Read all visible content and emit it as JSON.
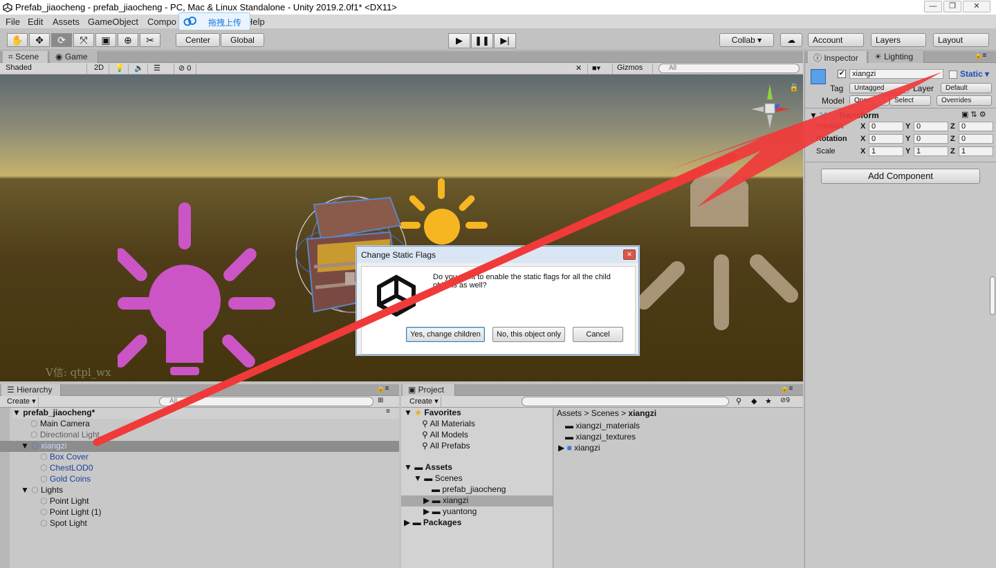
{
  "window": {
    "title": "Prefab_jiaocheng - prefab_jiaocheng - PC, Mac & Linux Standalone - Unity 2019.2.0f1* <DX11>",
    "min": "—",
    "max": "❐",
    "close": "✕"
  },
  "menu": [
    "File",
    "Edit",
    "Assets",
    "GameObject",
    "Compo",
    "Help"
  ],
  "upload_label": "拖拽上传",
  "toolbar": {
    "center": "Center",
    "global": "Global",
    "collab": "Collab ▾",
    "account": "Account",
    "layers": "Layers",
    "layout": "Layout"
  },
  "scene_tabs": {
    "scene": "Scene",
    "game": "Game",
    "shading": "Shaded",
    "mode2d": "2D",
    "hidden_count": "0",
    "gizmos": "Gizmos",
    "search_placeholder": "All",
    "watermark": "V信: qtpl_wx"
  },
  "dialog": {
    "title": "Change Static Flags",
    "message_line1": "Do you want to enable the static flags for all the child",
    "message_line2": "objects as well?",
    "yes": "Yes, change children",
    "no": "No, this object only",
    "cancel": "Cancel",
    "close": "✕"
  },
  "hierarchy": {
    "tab": "Hierarchy",
    "create": "Create",
    "search_placeholder": "All",
    "scene_name": "prefab_jiaocheng*",
    "items": [
      {
        "label": "Main Camera",
        "indent": 1,
        "style": "normal"
      },
      {
        "label": "Directional Light",
        "indent": 1,
        "style": "dim"
      },
      {
        "label": "xiangzi",
        "indent": 1,
        "style": "selected"
      },
      {
        "label": "Box Cover",
        "indent": 2,
        "style": "blue"
      },
      {
        "label": "ChestLOD0",
        "indent": 2,
        "style": "blue"
      },
      {
        "label": "Gold Coins",
        "indent": 2,
        "style": "blue"
      },
      {
        "label": "Lights",
        "indent": 1,
        "style": "normal"
      },
      {
        "label": "Point Light",
        "indent": 2,
        "style": "normal"
      },
      {
        "label": "Point Light (1)",
        "indent": 2,
        "style": "normal"
      },
      {
        "label": "Spot Light",
        "indent": 2,
        "style": "normal"
      }
    ]
  },
  "project": {
    "tab": "Project",
    "create": "Create",
    "hidden_count": "9",
    "favorites_label": "Favorites",
    "favorites": [
      "All Materials",
      "All Models",
      "All Prefabs"
    ],
    "assets_label": "Assets",
    "scenes_label": "Scenes",
    "scene_children": [
      "prefab_jiaocheng",
      "xiangzi",
      "yuantong"
    ],
    "packages_label": "Packages",
    "breadcrumb": [
      "Assets",
      "Scenes",
      "xiangzi"
    ],
    "files": [
      "xiangzi_materials",
      "xiangzi_textures",
      "xiangzi"
    ]
  },
  "inspector": {
    "tab": "Inspector",
    "lighting_tab": "Lighting",
    "object_name": "xiangzi",
    "static_label": "Static",
    "tag_label": "Tag",
    "tag_value": "Untagged",
    "layer_label": "Layer",
    "layer_value": "Default",
    "model_label": "Model",
    "open": "Open",
    "select": "Select",
    "overrides": "Overrides",
    "transform_label": "Transform",
    "position_label": "Position",
    "rotation_label": "Rotation",
    "scale_label": "Scale",
    "position": [
      "0",
      "0",
      "0"
    ],
    "rotation": [
      "0",
      "0",
      "0"
    ],
    "scale": [
      "1",
      "1",
      "1"
    ],
    "axes": [
      "X",
      "Y",
      "Z"
    ],
    "add_component": "Add Component"
  },
  "colors": {
    "annotation_arrow": "#f03a3a",
    "light_gizmo": "#cc55c6",
    "sun_gizmo": "#f5b622",
    "selected_row": "#8d8d8d"
  }
}
